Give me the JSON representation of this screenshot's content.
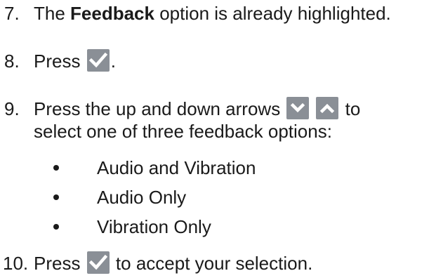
{
  "steps": [
    {
      "number": "7.",
      "before": "The ",
      "bold": "Feedback",
      "after": " option is already highlighted."
    },
    {
      "number": "8.",
      "before": "Press ",
      "after": ".",
      "icon": "checkmark-button-icon"
    },
    {
      "number": "9.",
      "line1_before": "Press the up and down arrows ",
      "line1_after": " to",
      "line2": "select one of three feedback options:",
      "icons": [
        "chevron-down-button-icon",
        "chevron-up-button-icon"
      ],
      "options": [
        "Audio and Vibration",
        "Audio Only",
        "Vibration Only"
      ]
    },
    {
      "number": "10.",
      "before": "Press ",
      "after": " to accept your selection.",
      "icon": "checkmark-button-icon"
    }
  ],
  "colors": {
    "text": "#1a1a1a",
    "icon_bg": "#8a8f96",
    "icon_fg": "#ffffff"
  }
}
